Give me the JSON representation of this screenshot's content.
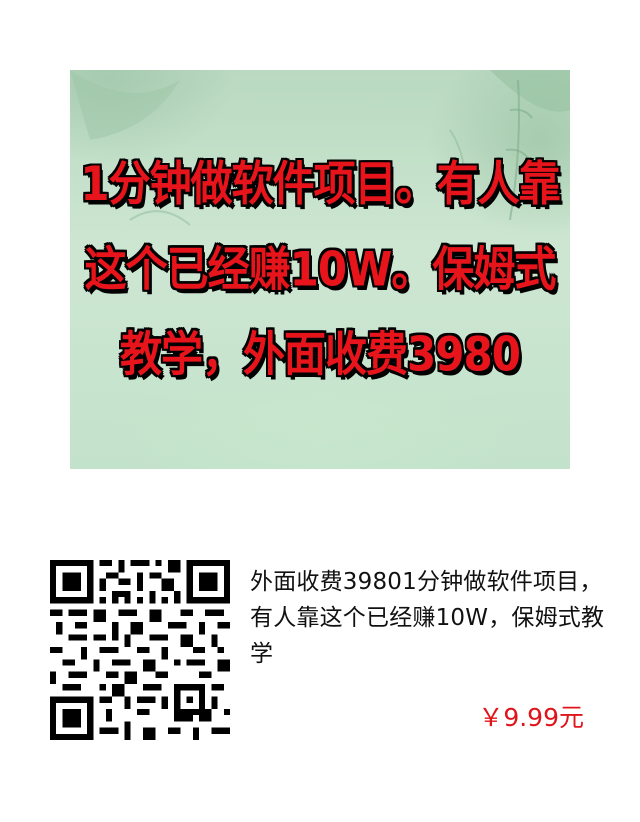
{
  "banner": {
    "headline": "1分钟做软件项目。有人靠这个已经赚10W。保姆式教学，外面收费3980"
  },
  "product": {
    "title": "外面收费39801分钟做软件项目，有人靠这个已经赚10W，保姆式教学",
    "price": "￥9.99元"
  },
  "colors": {
    "headline": "#e8141b",
    "price": "#e0141a",
    "banner_bg": "#c3e2cb"
  },
  "icons": [
    "qr-code"
  ]
}
